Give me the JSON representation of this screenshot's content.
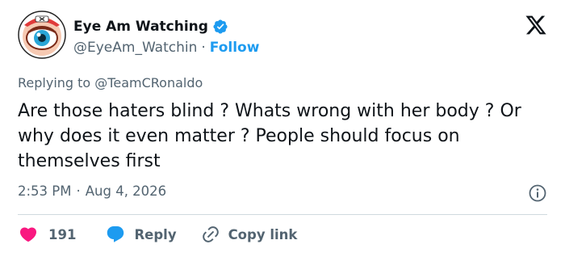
{
  "author": {
    "display_name": "Eye Am Watching",
    "handle": "@EyeAm_Watchin",
    "separator": "·",
    "follow_label": "Follow",
    "verified_icon": "verified-badge-icon",
    "verified_color": "#1d9bf0"
  },
  "reply_context": {
    "prefix": "Replying to",
    "mention": "@TeamCRonaldo"
  },
  "tweet": {
    "text": "Are those haters blind ? Whats wrong with her body ? Or why does it even matter ? People should focus on themselves first"
  },
  "meta": {
    "time": "2:53 PM",
    "separator": "·",
    "date": "Aug 4, 2026"
  },
  "actions": {
    "like_count": "191",
    "reply_label": "Reply",
    "copy_label": "Copy link"
  },
  "colors": {
    "accent": "#1d9bf0",
    "like": "#f91880",
    "text": "#0f1419",
    "secondary": "#536471",
    "divider": "#cfd9de"
  }
}
